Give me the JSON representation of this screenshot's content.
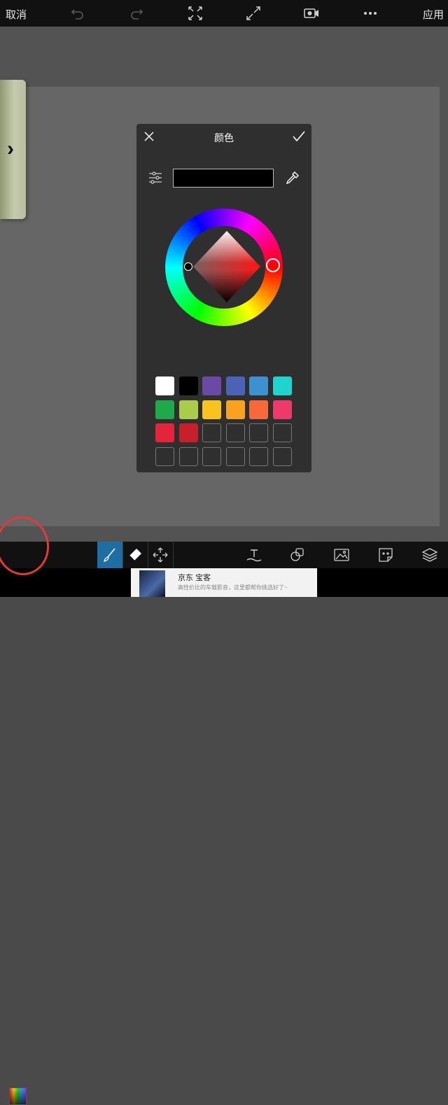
{
  "topbar": {
    "cancel_label": "取消",
    "apply_label": "应用",
    "icons": [
      "undo-icon",
      "redo-icon",
      "fit-screen-icon",
      "fullscreen-icon",
      "record-video-icon",
      "more-icon"
    ]
  },
  "dialog": {
    "title": "颜色",
    "hex_value": "",
    "selected_color": "#000000",
    "hue_color": "#ff0000",
    "swatches": [
      [
        "#ffffff",
        "#000000",
        "#6a4aa5",
        "#4a63b5",
        "#3a92cf",
        "#1fd3cf"
      ],
      [
        "#1fa94a",
        "#a9cc4a",
        "#f8c21f",
        "#f8a21f",
        "#f7683a",
        "#ee3a6a"
      ],
      [
        "#e3243a",
        "#c81f2a",
        "",
        "",
        "",
        ""
      ],
      [
        "",
        "",
        "",
        "",
        "",
        ""
      ]
    ]
  },
  "bottombar": {
    "tools": [
      "brush-icon",
      "eraser-icon",
      "move-icon",
      "text-icon",
      "shapes-icon",
      "image-icon",
      "sticker-icon",
      "layers-icon"
    ],
    "active_tool": "brush-icon"
  },
  "ad": {
    "title": "京东 宝客",
    "subtitle": "高性价比的车载影音，这里都帮你挑选好了~"
  }
}
